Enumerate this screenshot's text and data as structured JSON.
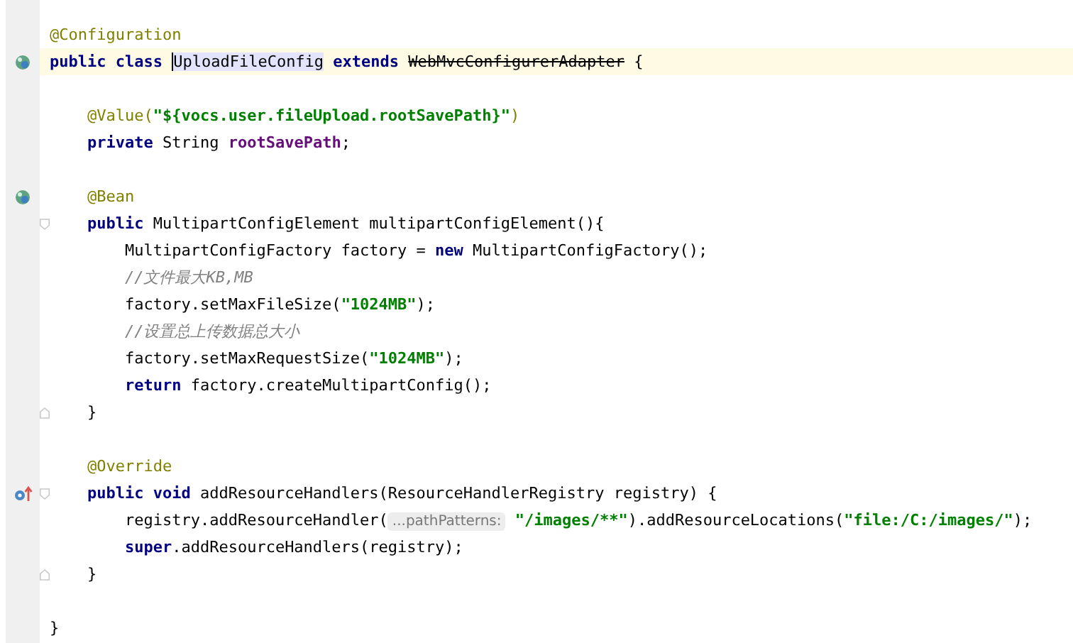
{
  "editor": {
    "lines": [
      {
        "kind": "code",
        "tokens": [
          {
            "text": "@Configuration",
            "kind": "annotation"
          }
        ]
      },
      {
        "kind": "code",
        "current": true,
        "bean_marker": true,
        "tokens": [
          {
            "text": "public class ",
            "kind": "keyword"
          },
          {
            "text": "UploadFileConfig",
            "kind": "highlight",
            "caret": true
          },
          {
            "text": " extends ",
            "kind": "keyword"
          },
          {
            "text": "WebMvcConfigurerAdapter",
            "kind": "deprecated"
          },
          {
            "text": " {",
            "kind": "plain"
          }
        ]
      },
      {
        "kind": "blank"
      },
      {
        "kind": "code",
        "tokens": [
          {
            "text": "    @Value(",
            "kind": "annotation"
          },
          {
            "text": "\"${vocs.user.fileUpload.rootSavePath}\"",
            "kind": "string"
          },
          {
            "text": ")",
            "kind": "annotation"
          }
        ]
      },
      {
        "kind": "code",
        "tokens": [
          {
            "text": "    private ",
            "kind": "keyword"
          },
          {
            "text": "String ",
            "kind": "plain"
          },
          {
            "text": "rootSavePath",
            "kind": "field"
          },
          {
            "text": ";",
            "kind": "plain"
          }
        ]
      },
      {
        "kind": "blank"
      },
      {
        "kind": "code",
        "bean_marker": true,
        "tokens": [
          {
            "text": "    @Bean",
            "kind": "annotation"
          }
        ]
      },
      {
        "kind": "code",
        "fold_start": true,
        "tokens": [
          {
            "text": "    public ",
            "kind": "keyword"
          },
          {
            "text": "MultipartConfigElement multipartConfigElement(){",
            "kind": "plain"
          }
        ]
      },
      {
        "kind": "code",
        "tokens": [
          {
            "text": "        MultipartConfigFactory factory = ",
            "kind": "plain"
          },
          {
            "text": "new ",
            "kind": "keyword"
          },
          {
            "text": "MultipartConfigFactory();",
            "kind": "plain"
          }
        ]
      },
      {
        "kind": "code",
        "tokens": [
          {
            "text": "        //文件最大KB,MB",
            "kind": "comment"
          }
        ]
      },
      {
        "kind": "code",
        "tokens": [
          {
            "text": "        factory.setMaxFileSize(",
            "kind": "plain"
          },
          {
            "text": "\"1024MB\"",
            "kind": "string"
          },
          {
            "text": ");",
            "kind": "plain"
          }
        ]
      },
      {
        "kind": "code",
        "tokens": [
          {
            "text": "        //设置总上传数据总大小",
            "kind": "comment"
          }
        ]
      },
      {
        "kind": "code",
        "tokens": [
          {
            "text": "        factory.setMaxRequestSize(",
            "kind": "plain"
          },
          {
            "text": "\"1024MB\"",
            "kind": "string"
          },
          {
            "text": ");",
            "kind": "plain"
          }
        ]
      },
      {
        "kind": "code",
        "tokens": [
          {
            "text": "        return ",
            "kind": "keyword"
          },
          {
            "text": "factory.createMultipartConfig();",
            "kind": "plain"
          }
        ]
      },
      {
        "kind": "code",
        "fold_end": true,
        "tokens": [
          {
            "text": "    }",
            "kind": "plain"
          }
        ]
      },
      {
        "kind": "blank"
      },
      {
        "kind": "code",
        "tokens": [
          {
            "text": "    @Override",
            "kind": "annotation"
          }
        ]
      },
      {
        "kind": "code",
        "override_marker": true,
        "fold_start": true,
        "tokens": [
          {
            "text": "    public void ",
            "kind": "keyword"
          },
          {
            "text": "addResourceHandlers(ResourceHandlerRegistry registry) {",
            "kind": "plain"
          }
        ]
      },
      {
        "kind": "code",
        "tokens": [
          {
            "text": "        registry.addResourceHandler(",
            "kind": "plain"
          },
          {
            "text": "...pathPatterns:",
            "kind": "hint"
          },
          {
            "text": " \"/images/**\"",
            "kind": "string"
          },
          {
            "text": ").addResourceLocations(",
            "kind": "plain"
          },
          {
            "text": "\"file:/C:/images/\"",
            "kind": "string"
          },
          {
            "text": ");",
            "kind": "plain"
          }
        ]
      },
      {
        "kind": "code",
        "tokens": [
          {
            "text": "        super",
            "kind": "keyword"
          },
          {
            "text": ".addResourceHandlers(registry);",
            "kind": "plain"
          }
        ]
      },
      {
        "kind": "code",
        "fold_end": true,
        "tokens": [
          {
            "text": "    }",
            "kind": "plain"
          }
        ]
      },
      {
        "kind": "blank"
      },
      {
        "kind": "code",
        "tokens": [
          {
            "text": "}",
            "kind": "plain"
          }
        ]
      }
    ]
  }
}
